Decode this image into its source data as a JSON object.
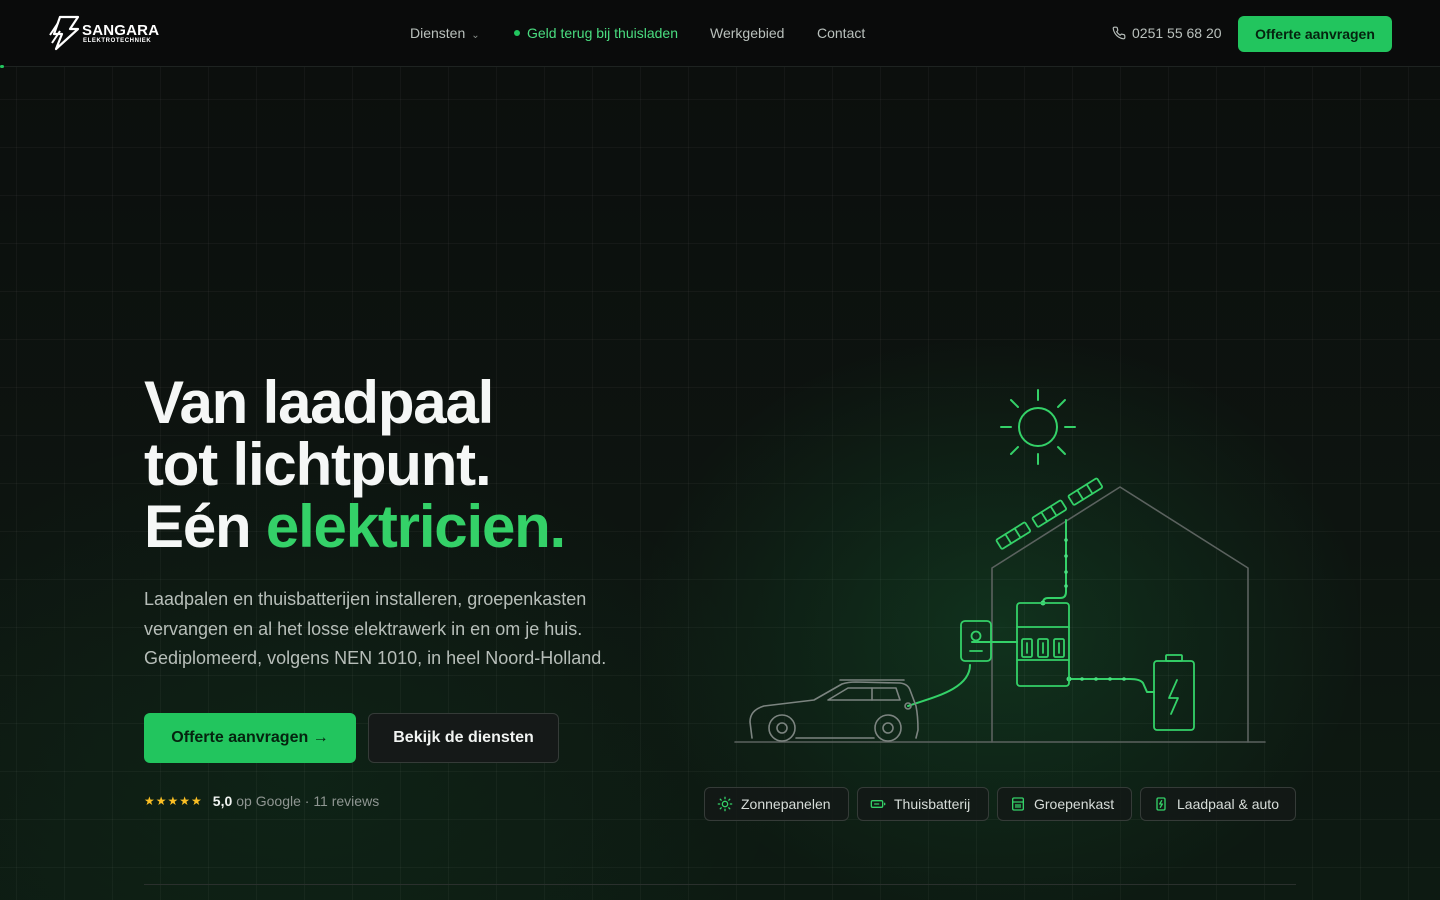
{
  "brand": {
    "name": "SANGARA",
    "subtitle": "ELEKTROTECHNIEK"
  },
  "nav": {
    "items": [
      {
        "label": "Diensten",
        "has_dropdown": true
      },
      {
        "label": "Geld terug bij thuisladen",
        "highlighted": true
      },
      {
        "label": "Werkgebied"
      },
      {
        "label": "Contact"
      }
    ],
    "phone": "0251 55 68 20",
    "cta": "Offerte aanvragen"
  },
  "hero": {
    "heading_line1": "Van laadpaal",
    "heading_line2": "tot lichtpunt.",
    "heading_line3_prefix": "Eén ",
    "heading_line3_accent": "elektricien.",
    "lede": "Laadpalen en thuisbatterijen installeren, groepenkasten vervangen en al het losse elektrawerk in en om je huis. Gediplomeerd, volgens NEN 1010, in heel Noord-Holland.",
    "primary_cta": "Offerte aanvragen →",
    "secondary_cta": "Bekijk de diensten",
    "rating": {
      "stars": "★★★★★",
      "score": "5,0",
      "text": "op Google · 11 reviews"
    }
  },
  "chips": [
    {
      "label": "Zonnepanelen",
      "icon": "sun-icon"
    },
    {
      "label": "Thuisbatterij",
      "icon": "battery-icon"
    },
    {
      "label": "Groepenkast",
      "icon": "fusebox-icon"
    },
    {
      "label": "Laadpaal & auto",
      "icon": "charger-icon"
    }
  ],
  "colors": {
    "accent": "#22c55e",
    "accent_text": "#34d168",
    "background": "#0b0d0c",
    "star": "#fbbf24"
  }
}
